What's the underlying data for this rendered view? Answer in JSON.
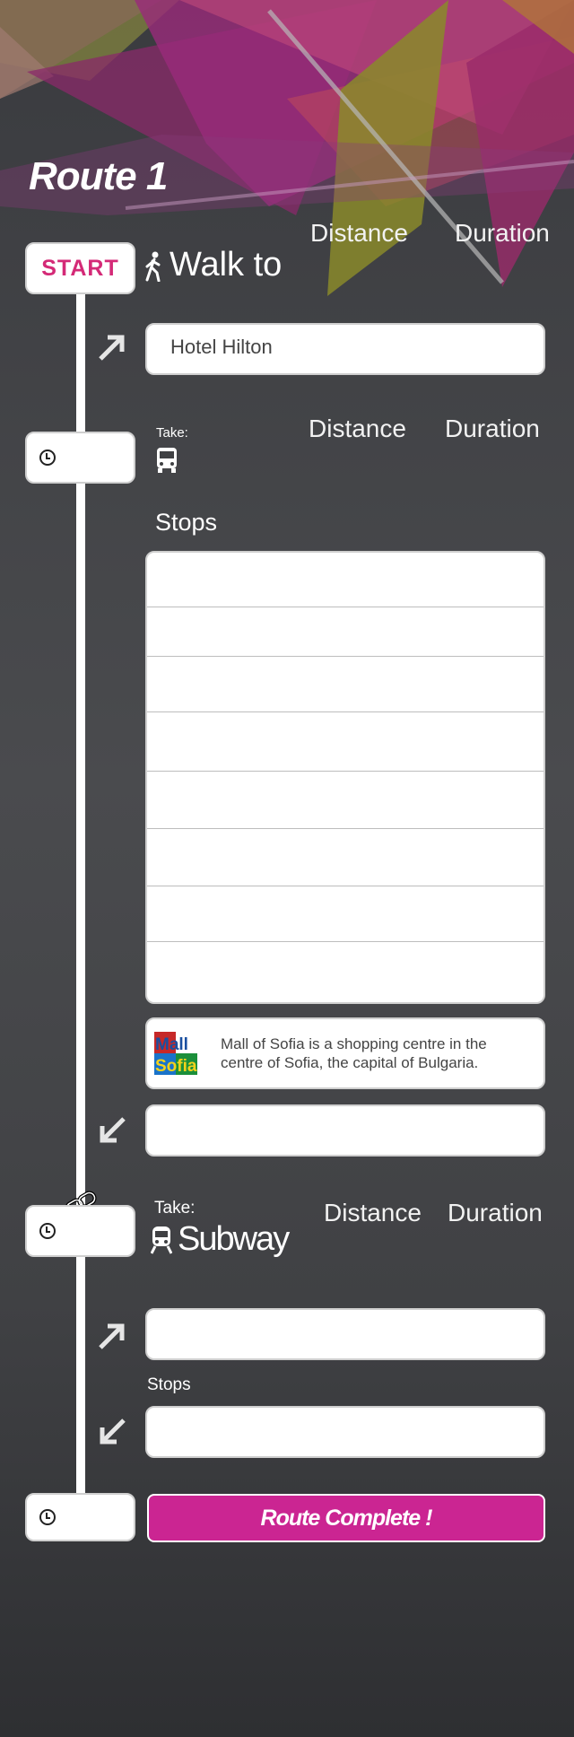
{
  "route": {
    "title": "Route 1"
  },
  "walk_segment": {
    "start_label": "START",
    "walk_label": "Walk to",
    "distance_label": "Distance",
    "duration_label": "Duration",
    "destination": "Hotel Hilton"
  },
  "bus_segment": {
    "take_label": "Take:",
    "distance_label": "Distance",
    "duration_label": "Duration",
    "stops_label": "Stops",
    "stops": [
      "",
      "",
      "",
      "",
      "",
      "",
      "",
      ""
    ],
    "info": {
      "logo_text": "Mall of Sofia",
      "description": "Mall of Sofia is a shopping centre in the centre of Sofia, the capital of Bulgaria."
    }
  },
  "subway_segment": {
    "take_label": "Take:",
    "mode": "Subway",
    "distance_label": "Distance",
    "duration_label": "Duration",
    "stops_label": "Stops"
  },
  "footer": {
    "complete_label": "Route Complete !"
  },
  "colors": {
    "accent": "#cb2592",
    "start_text": "#d42a77",
    "background": "#3f4043"
  }
}
